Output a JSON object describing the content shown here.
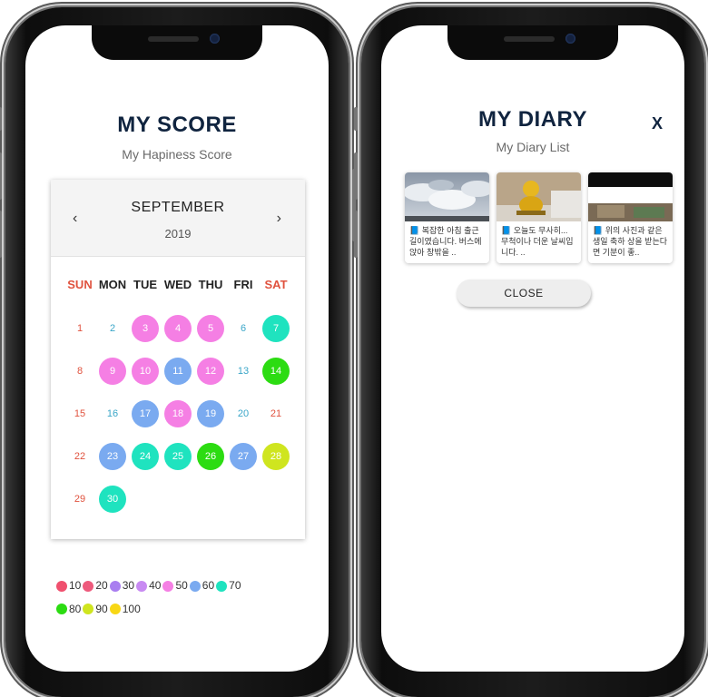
{
  "score_screen": {
    "title": "MY SCORE",
    "subtitle": "My Hapiness Score",
    "calendar": {
      "month": "SEPTEMBER",
      "year": "2019",
      "prev_icon": "chevron-left-icon",
      "next_icon": "chevron-right-icon",
      "weekdays": [
        "SUN",
        "MON",
        "TUE",
        "WED",
        "THU",
        "FRI",
        "SAT"
      ],
      "days": [
        {
          "d": "1",
          "score": null
        },
        {
          "d": "2",
          "score": null
        },
        {
          "d": "3",
          "score": 50
        },
        {
          "d": "4",
          "score": 50
        },
        {
          "d": "5",
          "score": 50
        },
        {
          "d": "6",
          "score": null
        },
        {
          "d": "7",
          "score": 70
        },
        {
          "d": "8",
          "score": null
        },
        {
          "d": "9",
          "score": 50
        },
        {
          "d": "10",
          "score": 50
        },
        {
          "d": "11",
          "score": 60
        },
        {
          "d": "12",
          "score": 50
        },
        {
          "d": "13",
          "score": null
        },
        {
          "d": "14",
          "score": 80
        },
        {
          "d": "15",
          "score": null
        },
        {
          "d": "16",
          "score": null
        },
        {
          "d": "17",
          "score": 60
        },
        {
          "d": "18",
          "score": 50
        },
        {
          "d": "19",
          "score": 60
        },
        {
          "d": "20",
          "score": null
        },
        {
          "d": "21",
          "score": null
        },
        {
          "d": "22",
          "score": null
        },
        {
          "d": "23",
          "score": 60
        },
        {
          "d": "24",
          "score": 70
        },
        {
          "d": "25",
          "score": 70
        },
        {
          "d": "26",
          "score": 80
        },
        {
          "d": "27",
          "score": 60
        },
        {
          "d": "28",
          "score": 90
        },
        {
          "d": "29",
          "score": null
        },
        {
          "d": "30",
          "score": 70
        }
      ]
    },
    "legend": [
      {
        "label": "10",
        "color": "#f0506e"
      },
      {
        "label": "20",
        "color": "#ee5a7c"
      },
      {
        "label": "30",
        "color": "#a97ef0"
      },
      {
        "label": "40",
        "color": "#c88af2"
      },
      {
        "label": "50",
        "color": "#f57fe4"
      },
      {
        "label": "60",
        "color": "#7aaaf0"
      },
      {
        "label": "70",
        "color": "#1fe3bf"
      },
      {
        "label": "80",
        "color": "#2cdc12"
      },
      {
        "label": "90",
        "color": "#cfe51f"
      },
      {
        "label": "100",
        "color": "#f8d715"
      }
    ],
    "colors": {
      "sunday": "#e0523e",
      "saturday": "#e0523e",
      "weekday": "#3aa6c8",
      "empty_text": "#e0523e"
    }
  },
  "diary_screen": {
    "title": "MY DIARY",
    "subtitle": "My Diary List",
    "close_x": "X",
    "entries": [
      {
        "icon": "book-icon",
        "text": "복잡한 아침 출근길이였습니다. 버스에 앉아 창밖을 ..",
        "image": "cloudy-sky-photo"
      },
      {
        "icon": "book-icon",
        "text": "오늘도 무사히... 무척이나 더운 날씨입니다. ..",
        "image": "golden-figure-photo"
      },
      {
        "icon": "book-icon",
        "text": "위의 사진과 같은 생일 축하 상을 받는다면 기분이 좋..",
        "image": "phone-screenshot-photo"
      }
    ],
    "close_button": "CLOSE"
  }
}
